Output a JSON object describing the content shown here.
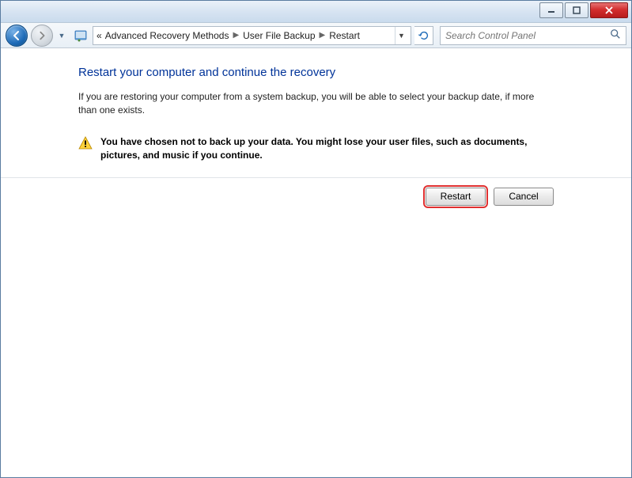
{
  "breadcrumb": {
    "prefix": "«",
    "parts": [
      "Advanced Recovery Methods",
      "User File Backup",
      "Restart"
    ]
  },
  "search": {
    "placeholder": "Search Control Panel"
  },
  "page": {
    "title": "Restart your computer and continue the recovery",
    "body": "If you are restoring your computer from a system backup, you will be able to select your backup date, if more than one exists.",
    "warning": "You have chosen not to back up your data. You might lose your user files, such as documents, pictures, and music if you continue."
  },
  "buttons": {
    "restart": "Restart",
    "cancel": "Cancel"
  }
}
